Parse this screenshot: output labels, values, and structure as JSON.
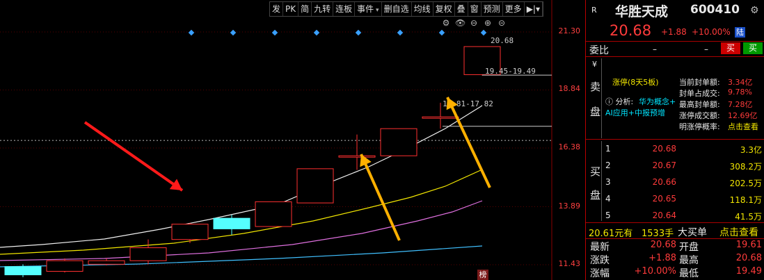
{
  "toolbar": [
    "发",
    "PK",
    "简",
    "九转",
    "连板",
    "事件",
    "删自选",
    "均线",
    "复权",
    "叠",
    "窗",
    "预测",
    "更多"
  ],
  "price_axis": [
    "21.30",
    "18.84",
    "16.38",
    "13.89",
    "11.43"
  ],
  "annotations": {
    "high": "20.68",
    "range1": "19.45-19.49",
    "range2": "16.81-17.82"
  },
  "stock": {
    "tag": "R",
    "name": "华胜天成",
    "code": "600410",
    "price": "20.68",
    "change": "+1.88",
    "pct": "+10.00%",
    "exchange_badge": "陆"
  },
  "order": {
    "label": "委比",
    "v1": "–",
    "v2": "–",
    "sell_btn": "买",
    "buy_btn": "买"
  },
  "sell_side": {
    "label1": "卖",
    "label2": "盘",
    "limit_status": "涨停(8天5板)",
    "analysis_prefix": "ⓘ 分析:",
    "analysis": "华为概念+",
    "analysis2": "AI应用+中报预增",
    "stats": [
      {
        "k": "当前封单额:",
        "v": "3.34亿"
      },
      {
        "k": "封单占成交:",
        "v": "9.78%"
      },
      {
        "k": "最高封单额:",
        "v": "7.28亿"
      },
      {
        "k": "涨停成交额:",
        "v": "12.69亿"
      },
      {
        "k": "明涨停概率:",
        "v": "点击查看"
      }
    ]
  },
  "buy_side": {
    "label1": "买",
    "label2": "盘",
    "rows": [
      {
        "n": "1",
        "p": "20.68",
        "v": "3.3亿"
      },
      {
        "n": "2",
        "p": "20.67",
        "v": "308.2万"
      },
      {
        "n": "3",
        "p": "20.66",
        "v": "202.5万"
      },
      {
        "n": "4",
        "p": "20.65",
        "v": "118.1万"
      },
      {
        "n": "5",
        "p": "20.64",
        "v": "41.5万"
      }
    ]
  },
  "big_order": {
    "price": "20.61元有",
    "vol": "1533手",
    "label": "大买单",
    "link": "点击查看"
  },
  "quote": [
    {
      "k1": "最新",
      "v1": "20.68",
      "k2": "开盘",
      "v2": "19.61"
    },
    {
      "k1": "涨跌",
      "v1": "+1.88",
      "k2": "最高",
      "v2": "20.68"
    },
    {
      "k1": "涨幅",
      "v1": "+10.00%",
      "k2": "最低",
      "v2": "19.49"
    }
  ],
  "side_badge": "榜",
  "chart_data": {
    "type": "candlestick",
    "y_range": [
      10.0,
      22.2
    ],
    "y_ticks": [
      21.3,
      18.84,
      16.38,
      13.89,
      11.43
    ],
    "candles": [
      {
        "o": 11.35,
        "c": 11.0,
        "h": 11.45,
        "l": 10.9,
        "color": "cyan"
      },
      {
        "o": 11.15,
        "c": 11.6,
        "h": 11.7,
        "l": 11.1,
        "color": "red"
      },
      {
        "o": 11.45,
        "c": 11.6,
        "h": 11.7,
        "l": 11.4,
        "color": "red"
      },
      {
        "o": 11.6,
        "c": 12.15,
        "h": 12.5,
        "l": 11.45,
        "color": "red"
      },
      {
        "o": 12.5,
        "c": 13.15,
        "h": 13.2,
        "l": 12.35,
        "color": "red"
      },
      {
        "o": 13.4,
        "c": 12.95,
        "h": 13.55,
        "l": 12.7,
        "color": "cyan"
      },
      {
        "o": 13.05,
        "c": 14.1,
        "h": 14.1,
        "l": 13.05,
        "color": "red"
      },
      {
        "o": 14.05,
        "c": 15.5,
        "h": 15.5,
        "l": 14.05,
        "color": "red"
      },
      {
        "o": 16.05,
        "c": 16.05,
        "h": 16.95,
        "l": 15.45,
        "color": "red"
      },
      {
        "o": 16.05,
        "c": 17.2,
        "h": 17.2,
        "l": 16.05,
        "color": "red"
      },
      {
        "o": 17.7,
        "c": 17.7,
        "h": 18.3,
        "l": 17.2,
        "color": "red"
      },
      {
        "o": 19.49,
        "c": 20.68,
        "h": 20.68,
        "l": 19.45,
        "color": "red"
      }
    ],
    "markers_count": 8
  }
}
